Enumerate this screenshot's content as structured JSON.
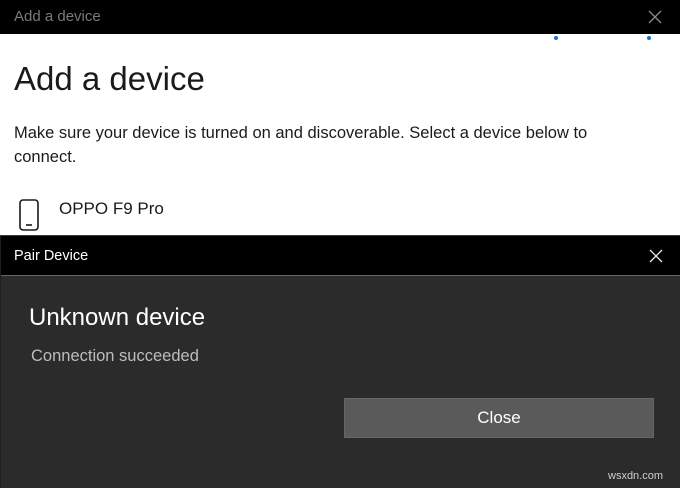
{
  "background_window": {
    "title": "Add a device",
    "heading": "Add a device",
    "description": "Make sure your device is turned on and discoverable. Select a device below to connect.",
    "devices": [
      {
        "name": "OPPO F9 Pro",
        "icon": "phone-icon"
      }
    ],
    "close_icon": "close-icon",
    "accent_color": "#1a6fd1"
  },
  "dialog": {
    "title": "Pair Device",
    "heading": "Unknown device",
    "status": "Connection succeeded",
    "close_button_label": "Close",
    "close_icon": "close-icon"
  },
  "watermark": "wsxdn.com"
}
